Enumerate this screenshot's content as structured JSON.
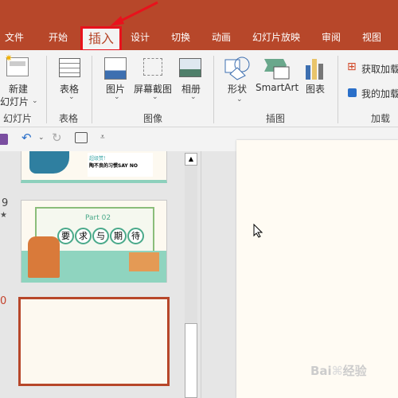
{
  "tabs": [
    "文件",
    "开始",
    "插入",
    "设计",
    "切换",
    "动画",
    "幻灯片放映",
    "审阅",
    "视图"
  ],
  "active_tab": "插入",
  "ribbon": {
    "new_slide": [
      "新建",
      "幻灯片"
    ],
    "table": "表格",
    "picture": "图片",
    "screenshot": "屏幕截图",
    "album": "相册",
    "shapes": "形状",
    "smartart": "SmartArt",
    "chart": "图表",
    "get_addins": "获取加载",
    "my_addins": "我的加载",
    "groups": [
      "幻灯片",
      "表格",
      "图像",
      "插图",
      "加载项"
    ]
  },
  "slides": [
    {
      "number": "",
      "text": [
        "超级赞！",
        "陶不良的习惯SAY NO"
      ]
    },
    {
      "number": "9",
      "title": "Part 02",
      "chars": [
        "要",
        "求",
        "与",
        "期",
        "待"
      ]
    },
    {
      "number": "10",
      "selected": true
    }
  ],
  "colors": {
    "accent": "#b7472a",
    "highlight": "#e8121c",
    "slide_bg": "#fffbf3"
  },
  "watermark": "Baidu 经验"
}
